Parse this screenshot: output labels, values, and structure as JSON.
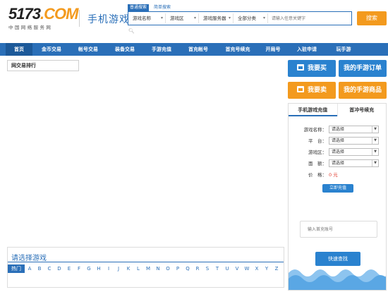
{
  "logo": {
    "main": "5173",
    "com": ".COM",
    "tagline": "中国网络服务网"
  },
  "header": {
    "title": "手机游戏"
  },
  "search": {
    "tabs": [
      "普通搜索",
      "简单搜索"
    ],
    "selects": [
      "游戏名称",
      "游戏区",
      "游戏服务器",
      "全部分类"
    ],
    "placeholder": "请输入任意关键字",
    "button": "搜索"
  },
  "nav": [
    "首页",
    "金币交易",
    "帐号交易",
    "装备交易",
    "手游充值",
    "首充帐号",
    "首充号续充",
    "开局号",
    "入驻申请",
    "玩手游"
  ],
  "rank": {
    "label": "网交易排行"
  },
  "actions": {
    "buy": "我要买",
    "my_orders": "我的手游订单",
    "sell": "我要卖",
    "my_goods": "我的手游商品"
  },
  "recharge": {
    "tabs": [
      "手机游戏充值",
      "首冲号续充"
    ],
    "fields": [
      {
        "label": "游戏名称：",
        "value": "请选择"
      },
      {
        "label": "平　台：",
        "value": "请选择"
      },
      {
        "label": "游戏区：",
        "value": "请选择"
      },
      {
        "label": "面　额：",
        "value": "请选择"
      }
    ],
    "price_label": "价　格：",
    "price_value": "0 元",
    "buy_button": "立即充值",
    "account_placeholder": "输入首充账号",
    "quick_button": "快速查找"
  },
  "games": {
    "title": "请选择游戏",
    "hot": "热门",
    "letters": [
      "A",
      "B",
      "C",
      "D",
      "E",
      "F",
      "G",
      "H",
      "I",
      "J",
      "K",
      "L",
      "M",
      "N",
      "O",
      "P",
      "Q",
      "R",
      "S",
      "T",
      "U",
      "V",
      "W",
      "X",
      "Y",
      "Z"
    ]
  },
  "colors": {
    "brand_blue": "#2a6fb8",
    "accent_orange": "#f39a1e",
    "button_blue": "#2a82cf"
  }
}
